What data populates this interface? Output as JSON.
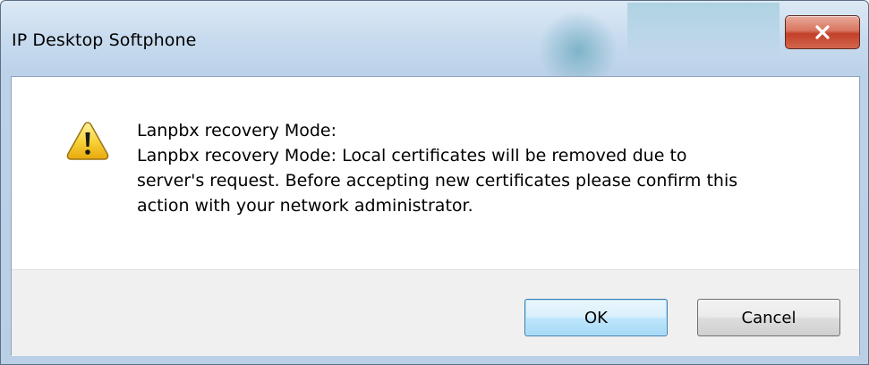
{
  "window": {
    "title": "IP Desktop Softphone",
    "close_icon": "close-icon"
  },
  "dialog": {
    "icon": "warning-icon",
    "message_lines": [
      "Lanpbx recovery Mode:",
      "Lanpbx recovery Mode: Local certificates will be removed due to",
      "server's request. Before accepting new certificates please confirm this",
      "action with your network administrator."
    ]
  },
  "buttons": {
    "ok_label": "OK",
    "cancel_label": "Cancel"
  },
  "colors": {
    "close_button": "#c2402a",
    "default_button_border": "#3c7fb1",
    "button_area_bg": "#f0f0f0"
  }
}
